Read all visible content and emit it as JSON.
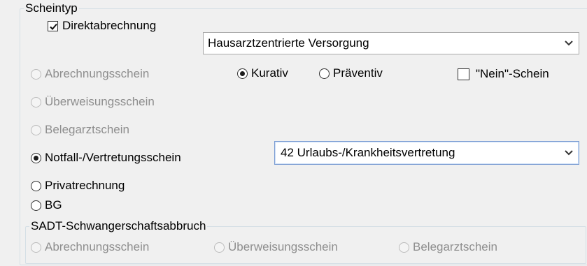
{
  "scheintyp": {
    "legend": "Scheintyp",
    "direktabrechnung": {
      "label": "Direktabrechnung",
      "checked": true
    },
    "versorgung_select": {
      "value": "Hausarztzentrierte Versorgung"
    },
    "options": [
      {
        "label": "Abrechnungsschein",
        "checked": false,
        "enabled": false
      },
      {
        "label": "Überweisungsschein",
        "checked": false,
        "enabled": false
      },
      {
        "label": "Belegarztschein",
        "checked": false,
        "enabled": false
      },
      {
        "label": "Notfall-/Vertretungsschein",
        "checked": true,
        "enabled": true
      },
      {
        "label": "Privatrechnung",
        "checked": false,
        "enabled": true
      },
      {
        "label": "BG",
        "checked": false,
        "enabled": true
      }
    ],
    "kurativ": {
      "label": "Kurativ",
      "checked": true
    },
    "praeventiv": {
      "label": "Präventiv",
      "checked": false
    },
    "nein_schein": {
      "label": "\"Nein\"-Schein",
      "checked": false
    },
    "vertretung_select": {
      "value": "42  Urlaubs-/Krankheitsvertretung"
    }
  },
  "sadt": {
    "legend": "SADT-Schwangerschaftsabbruch",
    "options": [
      {
        "label": "Abrechnungsschein",
        "enabled": false
      },
      {
        "label": "Überweisungsschein",
        "enabled": false
      },
      {
        "label": "Belegarztschein",
        "enabled": false
      }
    ]
  }
}
